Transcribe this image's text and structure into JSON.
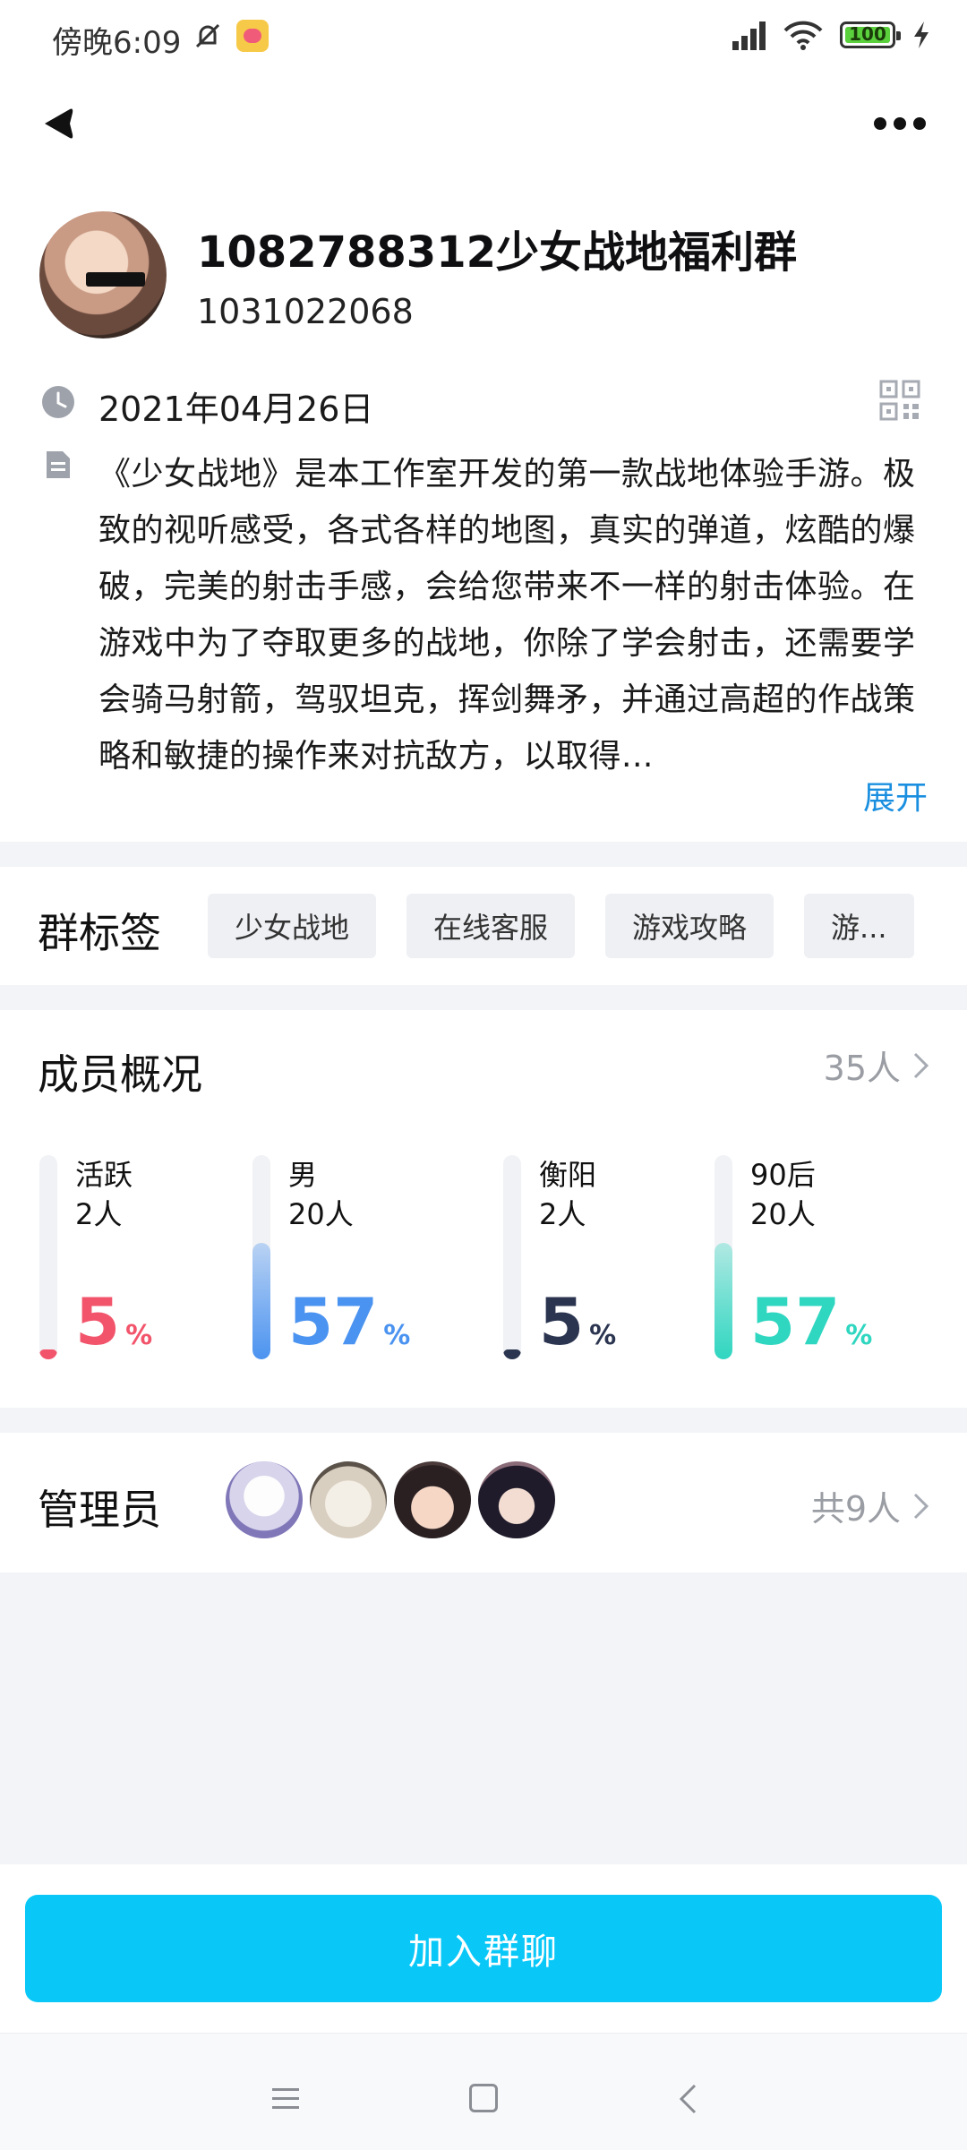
{
  "status_bar": {
    "time": "傍晚6:09",
    "battery": "100"
  },
  "group": {
    "name": "1082788312少女战地福利群",
    "id": "1031022068",
    "created_date": "2021年04月26日",
    "description": "《少女战地》是本工作室开发的第一款战地体验手游。极致的视听感受，各式各样的地图，真实的弹道，炫酷的爆破，完美的射击手感，会给您带来不一样的射击体验。在游戏中为了夺取更多的战地，你除了学会射击，还需要学会骑马射箭，驾驭坦克，挥剑舞矛，并通过高超的作战策略和敏捷的操作来对抗敌方，以取得...",
    "expand_label": "展开"
  },
  "tags": {
    "title": "群标签",
    "items": [
      "少女战地",
      "在线客服",
      "游戏攻略",
      "游..."
    ]
  },
  "members": {
    "title": "成员概况",
    "count": "35人",
    "stats": [
      {
        "label": "活跃",
        "count": "2人",
        "pct": "5",
        "fraction": 0.05,
        "color": "#f2546b"
      },
      {
        "label": "男",
        "count": "20人",
        "pct": "57",
        "fraction": 0.57,
        "color": "#4b93f0"
      },
      {
        "label": "衡阳",
        "count": "2人",
        "pct": "5",
        "fraction": 0.05,
        "color": "#2b3550"
      },
      {
        "label": "90后",
        "count": "20人",
        "pct": "57",
        "fraction": 0.57,
        "color": "#2fd6c0"
      }
    ],
    "pct_unit": "%"
  },
  "admins": {
    "title": "管理员",
    "count": "共9人",
    "avatars": [
      "admin-avatar-1",
      "admin-avatar-2",
      "admin-avatar-3",
      "admin-avatar-4"
    ]
  },
  "join_button": "加入群聊",
  "colors": {
    "accent": "#09c8f8",
    "link": "#1a8fe0"
  }
}
